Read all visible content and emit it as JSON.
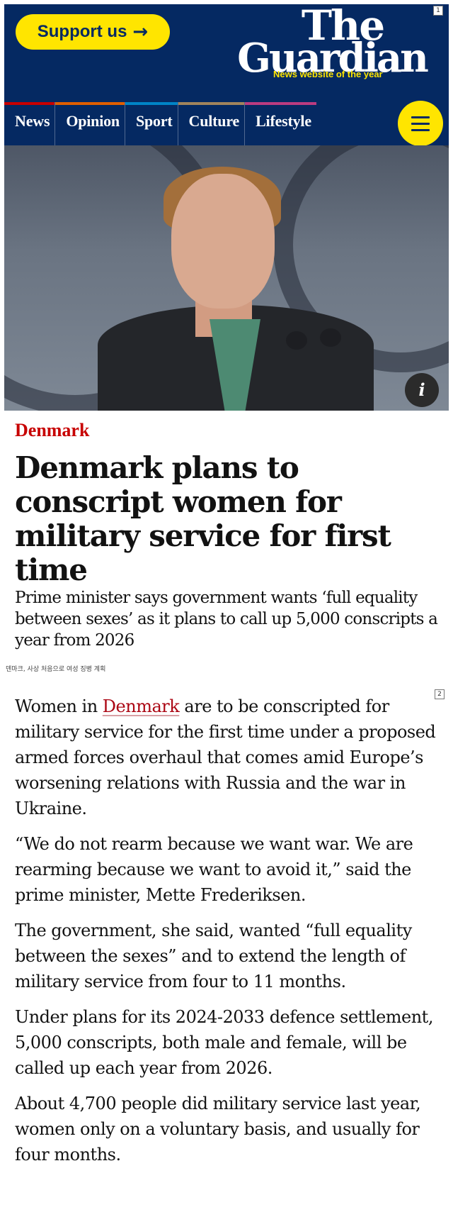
{
  "header": {
    "support_label": "Support us",
    "support_arrow": "→",
    "logo_line1": "The",
    "logo_line2": "Guardian",
    "logo_tagline": "News website of the year",
    "pillars": [
      {
        "label": "News",
        "color": "#c70000"
      },
      {
        "label": "Opinion",
        "color": "#e05e00"
      },
      {
        "label": "Sport",
        "color": "#0084c6"
      },
      {
        "label": "Culture",
        "color": "#a1845c"
      },
      {
        "label": "Lifestyle",
        "color": "#bb3b80"
      }
    ],
    "menu_icon": "hamburger-menu-icon"
  },
  "annotations": {
    "marker1": "1",
    "marker2": "2"
  },
  "hero": {
    "info_icon": "i"
  },
  "article": {
    "kicker": "Denmark",
    "headline": "Denmark plans to conscript women for military service for first time",
    "standfirst": "Prime minister says government wants ‘full equality between sexes’ as it plans to call up 5,000 conscripts a year from 2026",
    "korean_caption": "덴마크, 사상 처음으로 여성 징병 계획",
    "p1_before": "Women in ",
    "p1_link": "Denmark",
    "p1_after": " are to be conscripted for military service for the first time under a proposed armed forces overhaul that comes amid Europe’s worsening relations with Russia and the war in Ukraine.",
    "p2": "“We do not rearm because we want war. We are rearming because we want to avoid it,” said the prime minister, Mette Frederiksen.",
    "p3": "The government, she said, wanted “full equality between the sexes” and to extend the length of military service from four to 11 months.",
    "p4": "Under plans for its 2024-2033 defence settlement, 5,000 conscripts, both male and female, will be called up each year from 2026.",
    "p5": "About 4,700 people did military service last year, women only on a voluntary basis, and usually for four months."
  },
  "colors": {
    "brand": "#052962",
    "accent": "#ffe500",
    "kicker": "#c70000",
    "link": "#ab0613"
  }
}
